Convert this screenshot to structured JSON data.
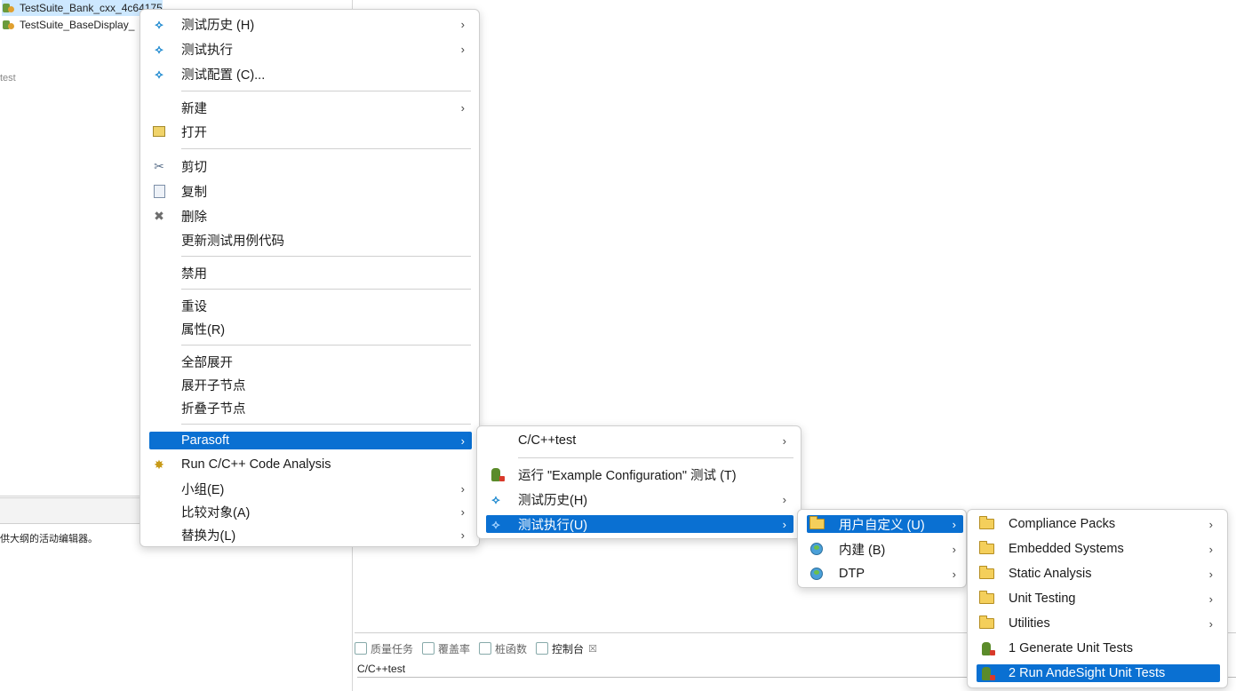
{
  "explorer": {
    "items": [
      {
        "label": "TestSuite_Bank_cxx_4c64175"
      },
      {
        "label": "TestSuite_BaseDisplay_"
      }
    ],
    "faint_label": "test",
    "outline_text": "供大纲的活动编辑器。"
  },
  "console": {
    "tabs": [
      {
        "label": "质量任务",
        "icon": "tasks-icon"
      },
      {
        "label": "覆盖率",
        "icon": "coverage-icon"
      },
      {
        "label": "桩函数",
        "icon": "stubs-icon"
      },
      {
        "label": "控制台",
        "icon": "console-icon",
        "close": "☒"
      }
    ],
    "content": "C/C++test"
  },
  "context_menu": {
    "items": [
      {
        "label": "测试历史 (H)",
        "icon": "test-history-icon",
        "submenu": true
      },
      {
        "label": "测试执行",
        "icon": "test-run-icon",
        "submenu": true
      },
      {
        "label": "测试配置 (C)...",
        "icon": "test-config-icon",
        "submenu": false
      },
      {
        "label": "新建",
        "submenu": true
      },
      {
        "label": "打开",
        "icon": "open-icon"
      },
      {
        "label": "剪切",
        "icon": "cut-icon"
      },
      {
        "label": "复制",
        "icon": "copy-icon"
      },
      {
        "label": "删除",
        "icon": "delete-icon"
      },
      {
        "label": "更新测试用例代码"
      },
      {
        "label": "禁用"
      },
      {
        "label": "重设"
      },
      {
        "label": "属性(R)"
      },
      {
        "label": "全部展开"
      },
      {
        "label": "展开子节点"
      },
      {
        "label": "折叠子节点"
      },
      {
        "label": "Parasoft",
        "submenu": true,
        "highlighted": true
      },
      {
        "label": "Run C/C++ Code Analysis",
        "icon": "code-analysis-icon"
      },
      {
        "label": "小组(E)",
        "submenu": true
      },
      {
        "label": "比较对象(A)",
        "submenu": true
      },
      {
        "label": "替换为(L)",
        "submenu": true
      }
    ]
  },
  "parasoft_menu": {
    "items": [
      {
        "label": "C/C++test",
        "submenu": true
      },
      {
        "label": "运行 \"Example Configuration\" 测试 (T)",
        "icon": "run-test-icon"
      },
      {
        "label": "测试历史(H)",
        "icon": "test-history-icon",
        "submenu": true
      },
      {
        "label": "测试执行(U)",
        "icon": "test-run-icon",
        "submenu": true,
        "highlighted": true
      }
    ]
  },
  "test_exec_menu": {
    "items": [
      {
        "label": "用户自定义 (U)",
        "icon": "folder-icon",
        "submenu": true,
        "highlighted": true
      },
      {
        "label": "内建 (B)",
        "icon": "builtin-icon",
        "submenu": true
      },
      {
        "label": "DTP",
        "icon": "dtp-icon",
        "submenu": true
      }
    ]
  },
  "user_defined_menu": {
    "items": [
      {
        "label": "Compliance Packs",
        "icon": "folder-icon",
        "submenu": true
      },
      {
        "label": "Embedded Systems",
        "icon": "folder-icon",
        "submenu": true
      },
      {
        "label": "Static Analysis",
        "icon": "folder-icon",
        "submenu": true
      },
      {
        "label": "Unit Testing",
        "icon": "folder-icon",
        "submenu": true
      },
      {
        "label": "Utilities",
        "icon": "folder-icon",
        "submenu": true
      },
      {
        "label": "1 Generate Unit Tests",
        "icon": "run-test-icon"
      },
      {
        "label": "2 Run AndeSight Unit Tests",
        "icon": "run-test-icon",
        "highlighted": true
      }
    ]
  },
  "glyphs": {
    "submenu_arrow": "›"
  },
  "colors": {
    "highlight": "#0a70d2",
    "selection": "#cde8ff"
  }
}
